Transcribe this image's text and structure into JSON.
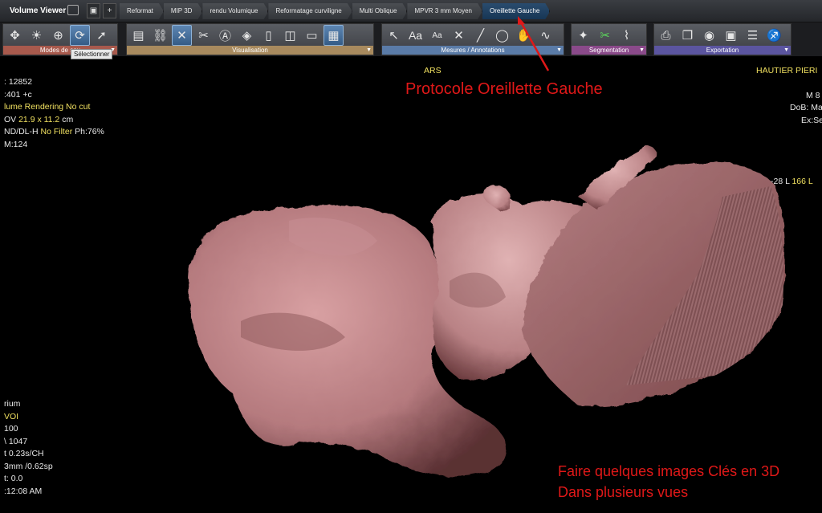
{
  "app": {
    "title": "Volume Viewer"
  },
  "tabs": [
    "Reformat",
    "MIP 3D",
    "rendu Volumique",
    "Reformatage curviligne",
    "Multi Oblique",
    "MPVR 3 mm Moyen",
    "Oreillette Gauche"
  ],
  "active_tab": "Oreillette Gauche",
  "toolbar": {
    "groups": [
      {
        "label": "Modes de sou",
        "tools": [
          "move-icon",
          "brightness-icon",
          "zoom-icon",
          "rotate-3d-icon",
          "pointer-icon"
        ]
      },
      {
        "label": "Visualisation",
        "tools": [
          "layout-icon",
          "link-icon",
          "crosshair-icon",
          "scissors-icon",
          "a-box-icon",
          "cube-icon",
          "l-box-icon",
          "vr-icon",
          "v-box-icon",
          "film-icon"
        ]
      },
      {
        "label": "Mesures / Annotations",
        "tools": [
          "arrow-icon",
          "text-aa-icon",
          "text-small-aa-icon",
          "cross-icon",
          "line-icon",
          "roi-icon",
          "hand-icon",
          "curve-icon"
        ]
      },
      {
        "label": "Segmentation",
        "tools": [
          "wand-icon",
          "scissor-green-icon",
          "curve-cut-icon"
        ]
      },
      {
        "label": "Exportation",
        "tools": [
          "print-icon",
          "copy-icon",
          "camera-icon",
          "save-disk-icon",
          "report-icon",
          "runner-icon"
        ]
      }
    ],
    "tooltip": "Sélectionner"
  },
  "overlay": {
    "top_center": "ARS",
    "top_right_name": "HAUTIER PIERI",
    "top_right_line2": "M 8",
    "top_right_line3": "DoB: Ma",
    "top_right_line4": "Ex:Se",
    "orientation_prefix": "-28 L ",
    "orientation_value": "166 L",
    "left_top": {
      "l1": ": 12852",
      "l2": ":401 +c",
      "l3": "lume Rendering No cut",
      "l4_prefix": "OV ",
      "l4_value": "21.9 x 11.2",
      "l4_unit": " cm",
      "l5_prefix": "ND/DL-H ",
      "l5_filter": "No Filter",
      "l5_suffix": " Ph:76%",
      "l6": "M:124"
    },
    "left_bottom": [
      "rium",
      "VOI",
      " 100",
      "\\ 1047",
      "t 0.23s/CH",
      "3mm /0.62sp",
      "t: 0.0",
      ":12:08 AM"
    ]
  },
  "annotations": {
    "protocol": "Protocole Oreillette Gauche",
    "instruction_line1": "Faire quelques images Clés en 3D",
    "instruction_line2": "Dans plusieurs vues"
  },
  "colors": {
    "annotation_red": "#e01818",
    "overlay_yellow": "#f0e060",
    "volume_pink": "#c98a8c"
  }
}
